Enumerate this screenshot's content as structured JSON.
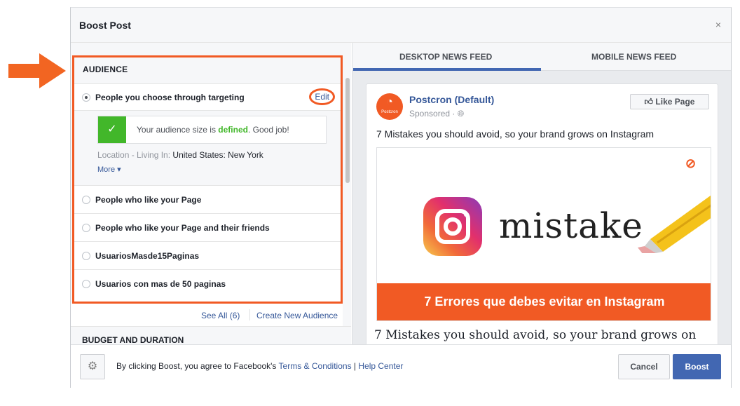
{
  "modal": {
    "title": "Boost Post",
    "close_icon": "×"
  },
  "audience": {
    "section_label": "AUDIENCE",
    "options": [
      {
        "label": "People you choose through targeting",
        "selected": true
      },
      {
        "label": "People who like your Page",
        "selected": false
      },
      {
        "label": "People who like your Page and their friends",
        "selected": false
      },
      {
        "label": "UsuariosMasde15Paginas",
        "selected": false
      },
      {
        "label": "Usuarios con mas de 50 paginas",
        "selected": false
      }
    ],
    "edit_label": "Edit",
    "size_prefix": "Your audience size is ",
    "size_status": "defined",
    "size_suffix": ". Good job!",
    "location_label": "Location - Living In: ",
    "location_value": "United States: New York",
    "more_label": "More ▾",
    "see_all_label": "See All (6)",
    "create_new_label": "Create New Audience"
  },
  "budget": {
    "section_label": "BUDGET AND DURATION"
  },
  "preview": {
    "tabs": [
      {
        "label": "DESKTOP NEWS FEED",
        "active": true
      },
      {
        "label": "MOBILE NEWS FEED",
        "active": false
      }
    ],
    "page_name": "Postcron (Default)",
    "avatar_text": "Postcron",
    "sponsored_label": "Sponsored · ",
    "like_page_label": "Like Page",
    "post_text": "7 Mistakes you should avoid, so your brand grows on Instagram",
    "image_word": "mistake",
    "banner_text": "7 Errores que debes evitar en Instagram",
    "headline": "7 Mistakes you should avoid, so your brand grows on"
  },
  "footer": {
    "terms_prefix": "By clicking Boost, you agree to Facebook's ",
    "terms_link": "Terms & Conditions",
    "separator": " | ",
    "help_link": "Help Center",
    "cancel_label": "Cancel",
    "boost_label": "Boost"
  },
  "colors": {
    "annotation_orange": "#f15a24",
    "facebook_blue": "#4267b2",
    "link_blue": "#365899",
    "success_green": "#42b72a"
  },
  "icons": {
    "check": "check-icon",
    "gear": "gear-icon",
    "globe": "globe-icon",
    "thumbs_up": "thumbs-up-icon",
    "arrow": "arrow-right-icon"
  }
}
